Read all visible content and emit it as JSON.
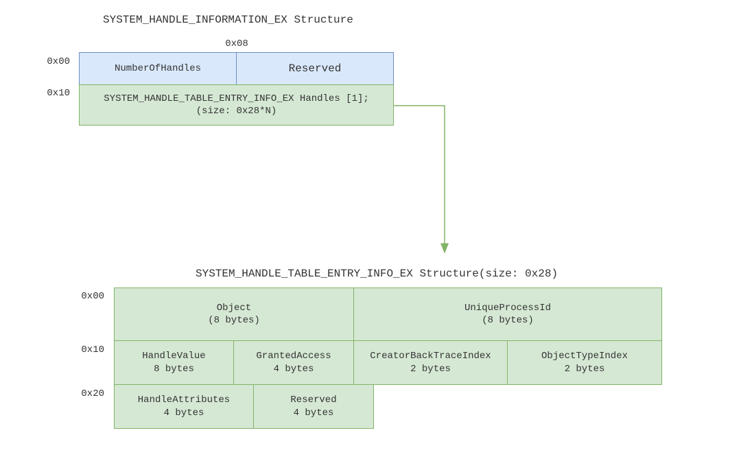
{
  "struct1": {
    "title": "SYSTEM_HANDLE_INFORMATION_EX Structure",
    "col_label": "0x08",
    "offsets": {
      "row0": "0x00",
      "row1": "0x10"
    },
    "cells": {
      "numberOfHandles": "NumberOfHandles",
      "reserved": "Reserved",
      "handlesArray_line1": "SYSTEM_HANDLE_TABLE_ENTRY_INFO_EX Handles [1];",
      "handlesArray_line2": "(size: 0x28*N)"
    }
  },
  "struct2": {
    "title": "SYSTEM_HANDLE_TABLE_ENTRY_INFO_EX Structure(size: 0x28)",
    "offsets": {
      "row0": "0x00",
      "row1": "0x10",
      "row2": "0x20"
    },
    "cells": {
      "object_l1": "Object",
      "object_l2": "(8 bytes)",
      "uniqueProcessId_l1": "UniqueProcessId",
      "uniqueProcessId_l2": "(8 bytes)",
      "handleValue_l1": "HandleValue",
      "handleValue_l2": "8 bytes",
      "grantedAccess_l1": "GrantedAccess",
      "grantedAccess_l2": "4 bytes",
      "creatorBackTraceIndex_l1": "CreatorBackTraceIndex",
      "creatorBackTraceIndex_l2": "2 bytes",
      "objectTypeIndex_l1": "ObjectTypeIndex",
      "objectTypeIndex_l2": "2 bytes",
      "handleAttributes_l1": "HandleAttributes",
      "handleAttributes_l2": "4 bytes",
      "reserved_l1": "Reserved",
      "reserved_l2": "4 bytes"
    }
  },
  "colors": {
    "blue_fill": "#dae8fc",
    "blue_border": "#6c8ebf",
    "green_fill": "#d5e8d4",
    "green_border": "#82b366",
    "arrow": "#82b366"
  }
}
